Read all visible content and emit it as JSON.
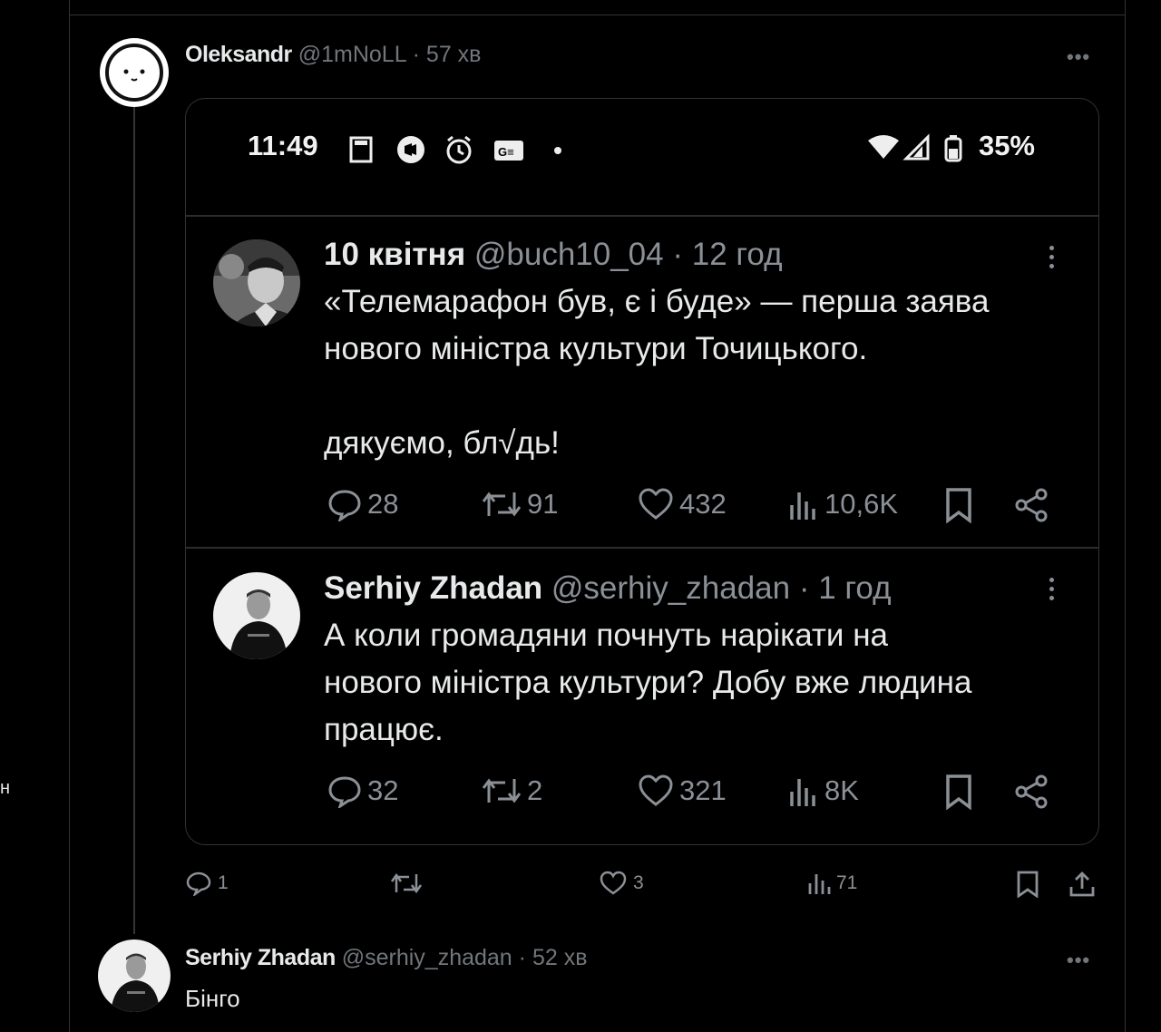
{
  "edge_glyph": "н",
  "post": {
    "name": "Oleksandr",
    "handle": "@1mNoLL",
    "dot": "·",
    "time": "57 хв",
    "more_label": "•••",
    "actions": {
      "reply": "1",
      "retweet": "",
      "like": "3",
      "views": "71"
    }
  },
  "screenshot": {
    "status_time": "11:49",
    "battery": "35%",
    "tweet1": {
      "name": "10 квітня",
      "handle": "@buch10_04",
      "dot": "·",
      "time": "12 год",
      "text": "«Телемарафон був, є і буде» — перша заява\nнового міністра культури Точицького.\n\nдякуємо, бл√дь!",
      "replies": "28",
      "retweets": "91",
      "likes": "432",
      "views": "10,6K"
    },
    "tweet2": {
      "name": "Serhiy Zhadan",
      "handle": "@serhiy_zhadan",
      "dot": "·",
      "time": "1 год",
      "text": "А коли громадяни почнуть нарікати на\nнового міністра культури? Добу вже людина\nпрацює.",
      "replies": "32",
      "retweets": "2",
      "likes": "321",
      "views": "8K"
    }
  },
  "reply": {
    "name": "Serhiy Zhadan",
    "handle": "@serhiy_zhadan",
    "dot": "·",
    "time": "52 хв",
    "text": "Бінго",
    "more_label": "•••"
  }
}
